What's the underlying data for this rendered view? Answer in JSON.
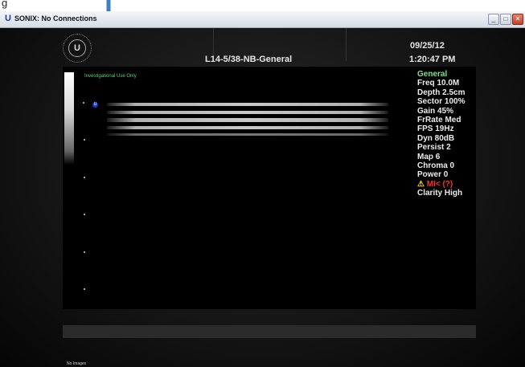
{
  "caption": {
    "text": "g"
  },
  "window": {
    "title": "SONIX: No Connections",
    "app_icon": "U",
    "buttons": {
      "minimize": "_",
      "maximize": "□",
      "close": "✕"
    }
  },
  "header": {
    "logo": "U",
    "preset": "L14-5/38-NB-General",
    "date": "09/25/12",
    "time": "1:20:47 PM"
  },
  "image": {
    "notice": "Investigational Use Only",
    "focus_marker": "U"
  },
  "params": {
    "mode": "General",
    "items": [
      "Freq 10.0M",
      "Depth 2.5cm",
      "Sector 100%",
      "Gain 45%",
      "FrRate Med",
      "FPS 19Hz",
      "Dyn 80dB",
      "Persist 2",
      "Map 6",
      "Chroma 0",
      "Power 0"
    ],
    "warning_icon": "⚠",
    "warning": "MI< (?)",
    "clarity": "Clarity High"
  },
  "footer": {
    "no_images": "No Images"
  },
  "colors": {
    "accent_green": "#7fe08a",
    "warning_red": "#ff3030",
    "arrow_blue": "#3f7fc4"
  }
}
